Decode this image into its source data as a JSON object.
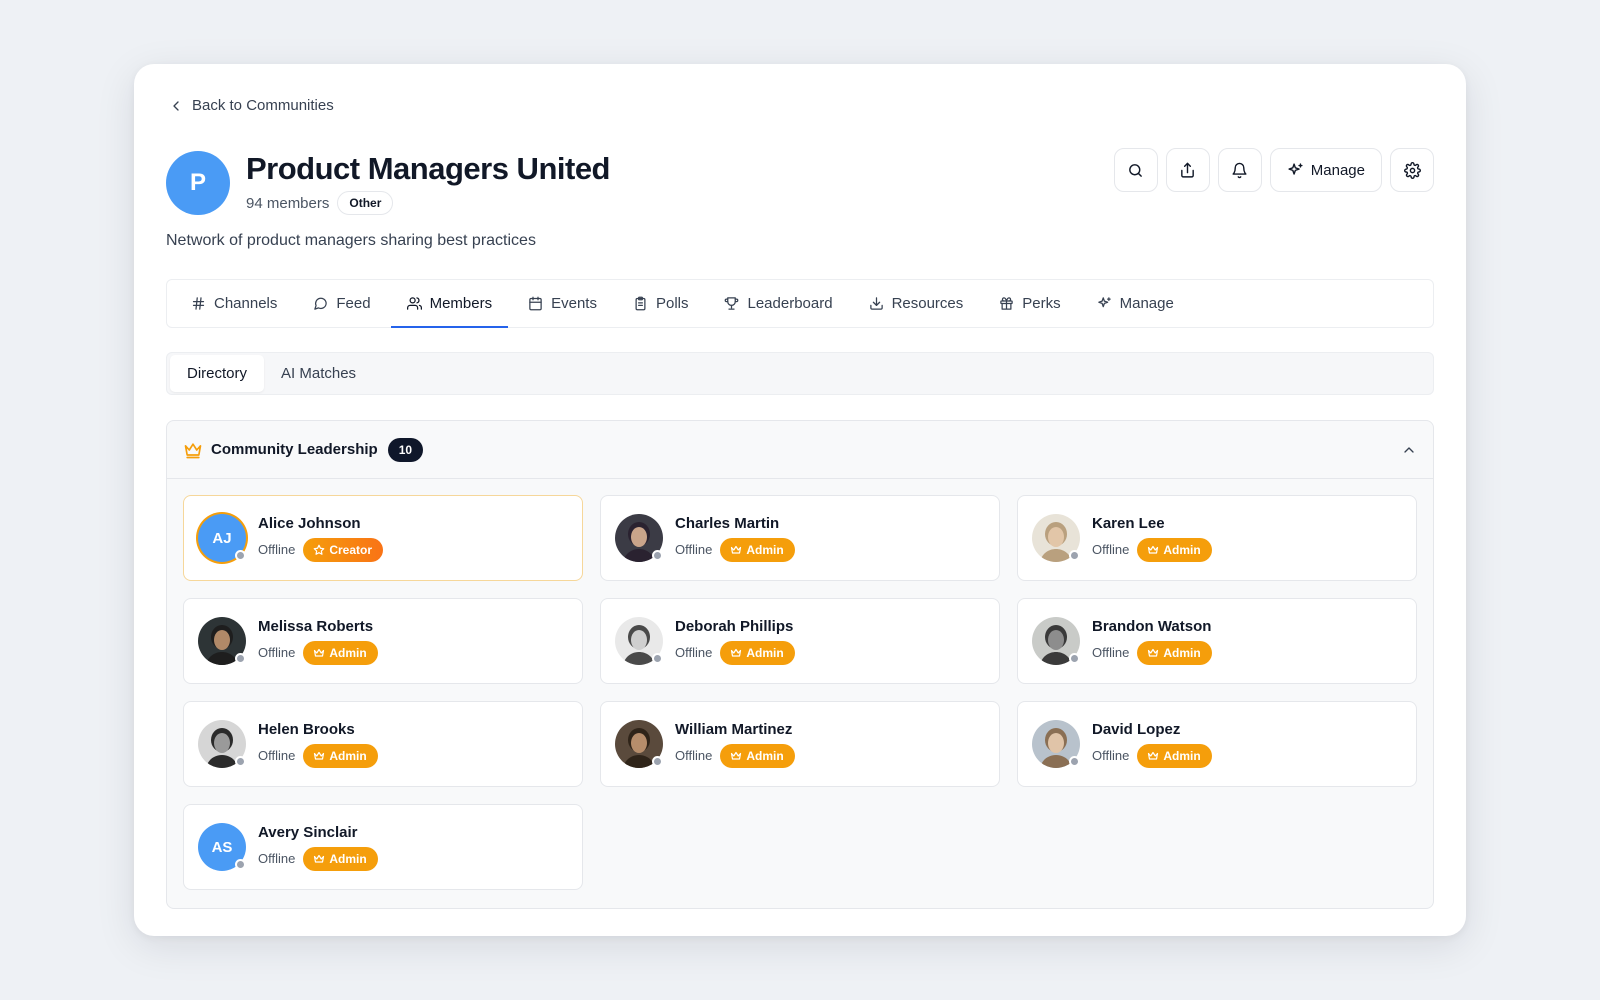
{
  "nav": {
    "back_label": "Back to Communities"
  },
  "community": {
    "initial": "P",
    "name": "Product Managers United",
    "member_count": "94 members",
    "category": "Other",
    "description": "Network of product managers sharing best practices"
  },
  "actions": {
    "manage_label": "Manage"
  },
  "tabs": [
    {
      "label": "Channels",
      "icon": "hash-icon"
    },
    {
      "label": "Feed",
      "icon": "message-circle-icon"
    },
    {
      "label": "Members",
      "icon": "users-icon",
      "active": true
    },
    {
      "label": "Events",
      "icon": "calendar-icon"
    },
    {
      "label": "Polls",
      "icon": "clipboard-icon"
    },
    {
      "label": "Leaderboard",
      "icon": "trophy-icon"
    },
    {
      "label": "Resources",
      "icon": "download-icon"
    },
    {
      "label": "Perks",
      "icon": "gift-icon"
    },
    {
      "label": "Manage",
      "icon": "sparkles-icon"
    }
  ],
  "subtabs": [
    {
      "label": "Directory",
      "active": true
    },
    {
      "label": "AI Matches"
    }
  ],
  "leadership": {
    "title": "Community Leadership",
    "count": "10",
    "members": [
      {
        "name": "Alice Johnson",
        "initials": "AJ",
        "status": "Offline",
        "role": "Creator",
        "photo": false
      },
      {
        "name": "Charles Martin",
        "status": "Offline",
        "role": "Admin",
        "photo": true
      },
      {
        "name": "Karen Lee",
        "status": "Offline",
        "role": "Admin",
        "photo": true
      },
      {
        "name": "Melissa Roberts",
        "status": "Offline",
        "role": "Admin",
        "photo": true
      },
      {
        "name": "Deborah Phillips",
        "status": "Offline",
        "role": "Admin",
        "photo": true
      },
      {
        "name": "Brandon Watson",
        "status": "Offline",
        "role": "Admin",
        "photo": true
      },
      {
        "name": "Helen Brooks",
        "status": "Offline",
        "role": "Admin",
        "photo": true
      },
      {
        "name": "William Martinez",
        "status": "Offline",
        "role": "Admin",
        "photo": true
      },
      {
        "name": "David Lopez",
        "status": "Offline",
        "role": "Admin",
        "photo": true
      },
      {
        "name": "Avery Sinclair",
        "initials": "AS",
        "status": "Offline",
        "role": "Admin",
        "photo": false
      }
    ]
  },
  "colors": {
    "accent": "#2563eb",
    "avatar_blue": "#4a9bf5",
    "admin_badge": "#f59e0b",
    "creator_badge": "#f97316",
    "offline_dot": "#9ca3af"
  }
}
